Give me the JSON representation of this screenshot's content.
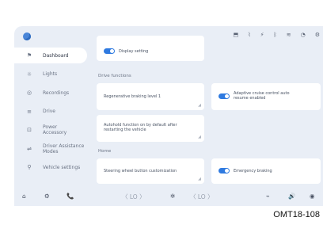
{
  "status_bar": {
    "icons": [
      "cast-icon",
      "battery-icon",
      "signal-icon",
      "bluetooth-icon",
      "wifi-icon",
      "clock-icon",
      "settings-icon"
    ],
    "glyphs": [
      "⬒",
      "⌇",
      "⚡",
      "ᛒ",
      "≋",
      "◔",
      "⚙"
    ]
  },
  "sidebar": {
    "items": [
      {
        "label": "Dashboard",
        "icon": "⚑",
        "active": true
      },
      {
        "label": "Lights",
        "icon": "☼",
        "active": false
      },
      {
        "label": "Recordings",
        "icon": "◎",
        "active": false
      },
      {
        "label": "Drive",
        "icon": "≡",
        "active": false
      },
      {
        "label": "Power\nAccessory",
        "icon": "⊡",
        "active": false
      },
      {
        "label": "Driver Assistance\nModes",
        "icon": "⇌",
        "active": false
      },
      {
        "label": "Vehicle settings",
        "icon": "⚲",
        "active": false
      }
    ]
  },
  "main": {
    "top_card_text": "Display setting",
    "section_1": "Drive functions",
    "card_a_text": "Regenerative braking level 1",
    "card_b_text": "Adaptive cruise control auto\nresume enabled",
    "card_c_text": "Autohold function on by default after\nrestarting the vehicle",
    "section_2": "Home",
    "card_d_text": "Steering wheel button customization",
    "card_e_text": "Emergency braking"
  },
  "bottom_nav": {
    "left": [
      "⌂",
      "⚙",
      "📞"
    ],
    "temp_left": "〈  LO  〉",
    "fan": "✲",
    "temp_right": "〈  LO  〉",
    "right": [
      "⌁",
      "🔊",
      "◉"
    ]
  },
  "caption": "OMT18-108"
}
